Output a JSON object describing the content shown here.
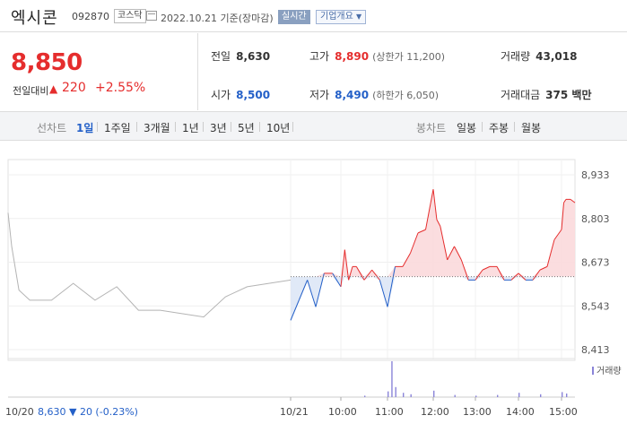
{
  "header": {
    "name": "엑시콘",
    "code": "092870",
    "market": "코스닥",
    "date_text": "2022.10.21 기준(장마감)",
    "realtime_label": "실시간",
    "corp_info_label": "기업개요"
  },
  "summary": {
    "price": "8,850",
    "change_label": "전일대비",
    "change_value": "220",
    "change_pct": "+2.55%",
    "prev_label": "전일",
    "prev_value": "8,630",
    "open_label": "시가",
    "open_value": "8,500",
    "high_label": "고가",
    "high_value": "8,890",
    "upper_limit": "(상한가 11,200)",
    "low_label": "저가",
    "low_value": "8,490",
    "lower_limit": "(하한가 6,050)",
    "volume_label": "거래량",
    "volume_value": "43,018",
    "amount_label": "거래대금",
    "amount_value": "375 백만"
  },
  "periods": {
    "label": "선차트",
    "tabs": [
      "1일",
      "1주일",
      "3개월",
      "1년",
      "3년",
      "5년",
      "10년"
    ],
    "active": "1일",
    "candle_label": "봉차트",
    "candle_tabs": [
      "일봉",
      "주봉",
      "월봉"
    ]
  },
  "colors": {
    "up": "#e52d2d",
    "down": "#2460c8",
    "prev_day_line": "#b4b4b4",
    "volume": "#8a84d8"
  },
  "chart_data": {
    "type": "line",
    "y_ticks": [
      "8,933",
      "8,803",
      "8,673",
      "8,543",
      "8,413"
    ],
    "ylim": [
      8413,
      8933
    ],
    "x_ticks": [
      "10/20",
      "10/21",
      "10:00",
      "11:00",
      "12:00",
      "13:00",
      "14:00",
      "15:00"
    ],
    "baseline": 8630,
    "footer_text": "10/20  8,630 ▼ 20 (-0.23%)",
    "volume_legend": "거래량",
    "grid": true,
    "series": [
      {
        "x": [
          "10/20 09:00",
          "10/20 09:05",
          "10/20 09:15",
          "10/20 09:30",
          "10/20 10:00",
          "10/20 10:30",
          "10/20 11:00",
          "10/20 11:30",
          "10/20 12:00",
          "10/20 12:30",
          "10/20 13:00",
          "10/20 13:30",
          "10/20 14:00",
          "10/20 14:30",
          "10/20 15:00",
          "10/20 15:30"
        ],
        "values": [
          8820,
          8720,
          8590,
          8560,
          8560,
          8610,
          8560,
          8600,
          8530,
          8530,
          8520,
          8510,
          8570,
          8600,
          8610,
          8620
        ]
      },
      {
        "x": [
          "09:00",
          "09:10",
          "09:20",
          "09:30",
          "09:40",
          "09:50",
          "10:00",
          "10:05",
          "10:10",
          "10:15",
          "10:20",
          "10:30",
          "10:40",
          "10:50",
          "11:00",
          "11:10",
          "11:20",
          "11:30",
          "11:40",
          "11:50",
          "12:00",
          "12:05",
          "12:10",
          "12:20",
          "12:30",
          "12:40",
          "12:50",
          "13:00",
          "13:10",
          "13:20",
          "13:30",
          "13:40",
          "13:50",
          "14:00",
          "14:10",
          "14:20",
          "14:30",
          "14:40",
          "14:50",
          "15:00",
          "15:05",
          "15:10",
          "15:20",
          "15:30"
        ],
        "values": [
          8500,
          8560,
          8620,
          8540,
          8640,
          8640,
          8600,
          8710,
          8620,
          8660,
          8660,
          8620,
          8650,
          8620,
          8540,
          8660,
          8660,
          8700,
          8760,
          8770,
          8890,
          8800,
          8780,
          8680,
          8720,
          8680,
          8620,
          8620,
          8650,
          8660,
          8660,
          8620,
          8620,
          8640,
          8620,
          8620,
          8650,
          8660,
          8740,
          8770,
          8850,
          8860,
          8860,
          8850
        ]
      }
    ],
    "volume": {
      "x": [
        "10:30",
        "11:00",
        "11:05",
        "11:10",
        "11:20",
        "11:30",
        "12:00",
        "12:30",
        "13:00",
        "13:30",
        "14:00",
        "14:30",
        "15:00",
        "15:10"
      ],
      "values": [
        200,
        800,
        5000,
        1400,
        600,
        400,
        900,
        300,
        200,
        300,
        600,
        400,
        700,
        500
      ]
    }
  }
}
